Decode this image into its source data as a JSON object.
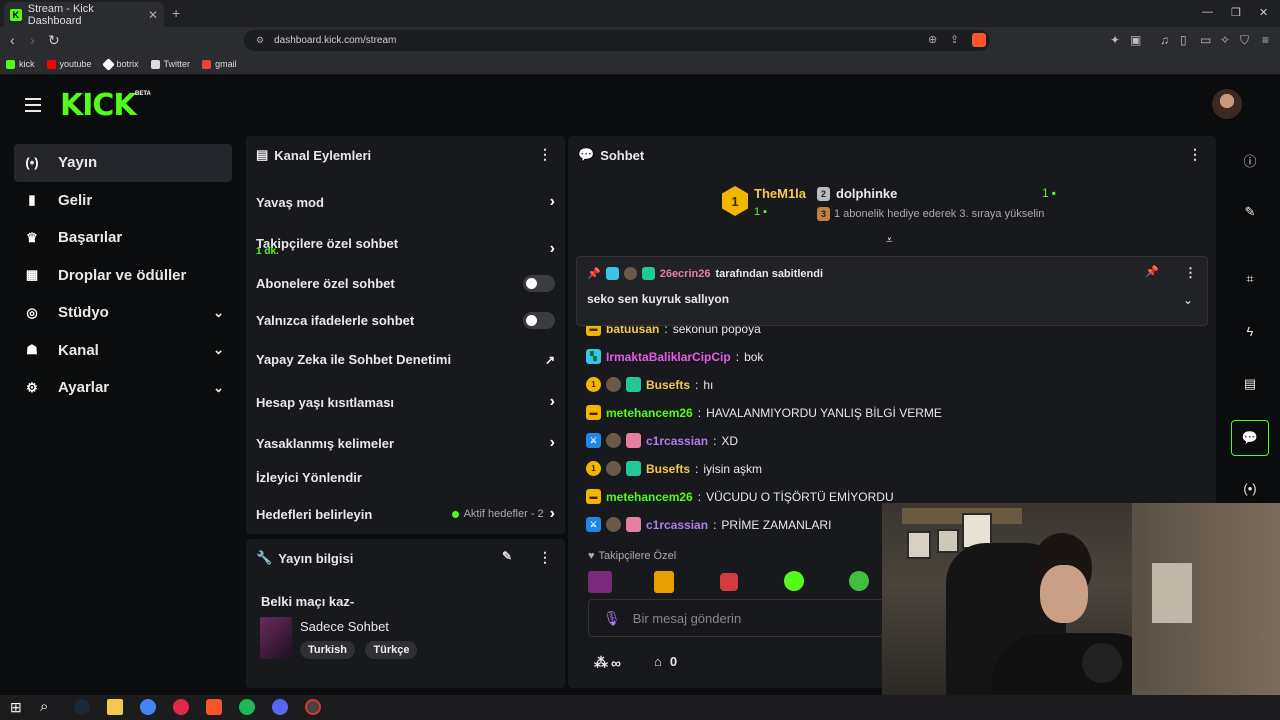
{
  "browser": {
    "tab_title": "Stream - Kick Dashboard",
    "tab_favicon": "K",
    "url": "dashboard.kick.com/stream",
    "bookmarks": [
      {
        "label": "kick",
        "color": "#53fc18"
      },
      {
        "label": "youtube",
        "color": "#ff0000"
      },
      {
        "label": "botrix",
        "color": "#ffffff"
      },
      {
        "label": "Twitter",
        "color": "#dddddd"
      },
      {
        "label": "gmail",
        "color": "#ea4335"
      }
    ]
  },
  "header": {
    "logo": "KICK",
    "logo_badge": "BETA"
  },
  "sidebar": {
    "items": [
      {
        "label": "Yayın",
        "icon": "broadcast-icon",
        "glyph": "(•)"
      },
      {
        "label": "Gelir",
        "icon": "revenue-icon",
        "glyph": "▮"
      },
      {
        "label": "Başarılar",
        "icon": "trophy-icon",
        "glyph": "🏆"
      },
      {
        "label": "Droplar ve ödüller",
        "icon": "drops-icon",
        "glyph": "▦"
      },
      {
        "label": "Stüdyo",
        "icon": "studio-icon",
        "glyph": "◎"
      },
      {
        "label": "Kanal",
        "icon": "channel-icon",
        "glyph": "☗"
      },
      {
        "label": "Ayarlar",
        "icon": "settings-icon",
        "glyph": "⚙"
      }
    ]
  },
  "channel_actions": {
    "title": "Kanal Eylemleri",
    "rows": {
      "slow_mode": "Yavaş mod",
      "followers_only": "Takipçilere özel sohbet",
      "followers_only_value": "1 dk.",
      "subscribers_only": "Abonelere özel sohbet",
      "emotes_only": "Yalnızca ifadelerle sohbet",
      "ai_moderation": "Yapay Zeka ile Sohbet Denetimi",
      "age_restriction": "Hesap yaşı kısıtlaması",
      "banned_words": "Yasaklanmış kelimeler",
      "raid": "İzleyici Yönlendir",
      "goals": "Hedefleri belirleyin",
      "goals_status": "Aktif hedefler - 2"
    }
  },
  "stream_info": {
    "title": "Yayın bilgisi",
    "stream_title": "Belki maçı kaz-",
    "category": "Sadece Sohbet",
    "tags": [
      "Turkish",
      "Türkçe"
    ]
  },
  "chat": {
    "title": "Sohbet",
    "leaderboard": {
      "first_user": "TheM1la",
      "first_rank": "1",
      "first_count": "1",
      "second_user": "dolphinke",
      "second_rank": "2",
      "second_count": "1",
      "third_rank": "3",
      "third_text": "1 abonelik hediye ederek 3. sıraya yükselin"
    },
    "pinned": {
      "pinned_by_user": "26ecrin26",
      "pinned_by_text": "tarafından sabitlendi",
      "message": "seko sen kuyruk sallıyon"
    },
    "messages": [
      {
        "user": "batuusan",
        "text": "sekonun popoya",
        "color": "#f2c94c"
      },
      {
        "user": "IrmaktaBaliklarCipCip",
        "text": "bok",
        "color": "#e65be6"
      },
      {
        "user": "Busefts",
        "text": "hı",
        "color": "#f2c94c"
      },
      {
        "user": "metehancem26",
        "text": "HAVALANMIYORDU YANLIŞ BİLGİ VERME",
        "color": "#53fc18"
      },
      {
        "user": "c1rcassian",
        "text": "XD",
        "color": "#b07cf0"
      },
      {
        "user": "Busefts",
        "text": "iyisin aşkm",
        "color": "#f2c94c"
      },
      {
        "user": "metehancem26",
        "text": "VÜCUDU O TİŞÖRTÜ EMİYORDU",
        "color": "#53fc18"
      },
      {
        "user": "c1rcassian",
        "text": "PRİME ZAMANLARI",
        "color": "#b07cf0"
      }
    ],
    "mode_label": "Takipçilere Özel",
    "input_placeholder": "Bir mesaj gönderin",
    "viewer_count": "∞",
    "store_count": "0"
  }
}
